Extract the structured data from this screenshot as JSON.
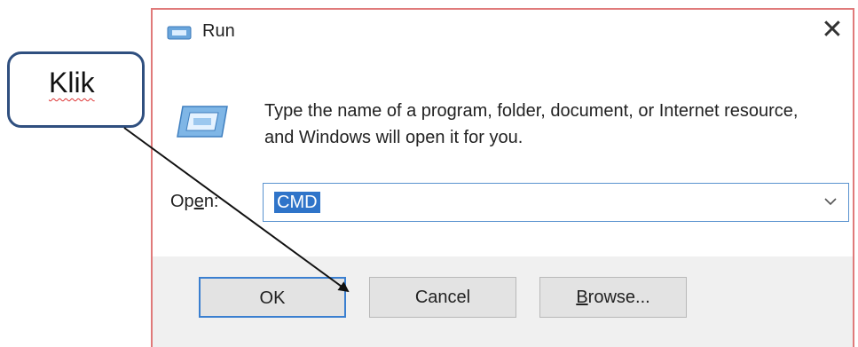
{
  "window": {
    "title": "Run",
    "close_glyph": "✕",
    "icon": "run-icon"
  },
  "body": {
    "description": "Type the name of a program, folder, document, or Internet resource, and Windows will open it for you.",
    "big_icon": "run-icon"
  },
  "open_field": {
    "label_prefix": "Op",
    "label_underlined": "e",
    "label_suffix": "n:",
    "value": "CMD",
    "dropdown_icon": "chevron-down-icon"
  },
  "buttons": {
    "ok": "OK",
    "cancel": "Cancel",
    "browse_underlined": "B",
    "browse_rest": "rowse..."
  },
  "annotation": {
    "callout_text": "Klik",
    "callout_border_color": "#2f4f7f",
    "arrow_color": "#111111"
  },
  "colors": {
    "dialog_border": "#e07a7a",
    "selection": "#2f74c9",
    "focus_border": "#3a7fd0",
    "footer_bg": "#f0f0f0"
  }
}
